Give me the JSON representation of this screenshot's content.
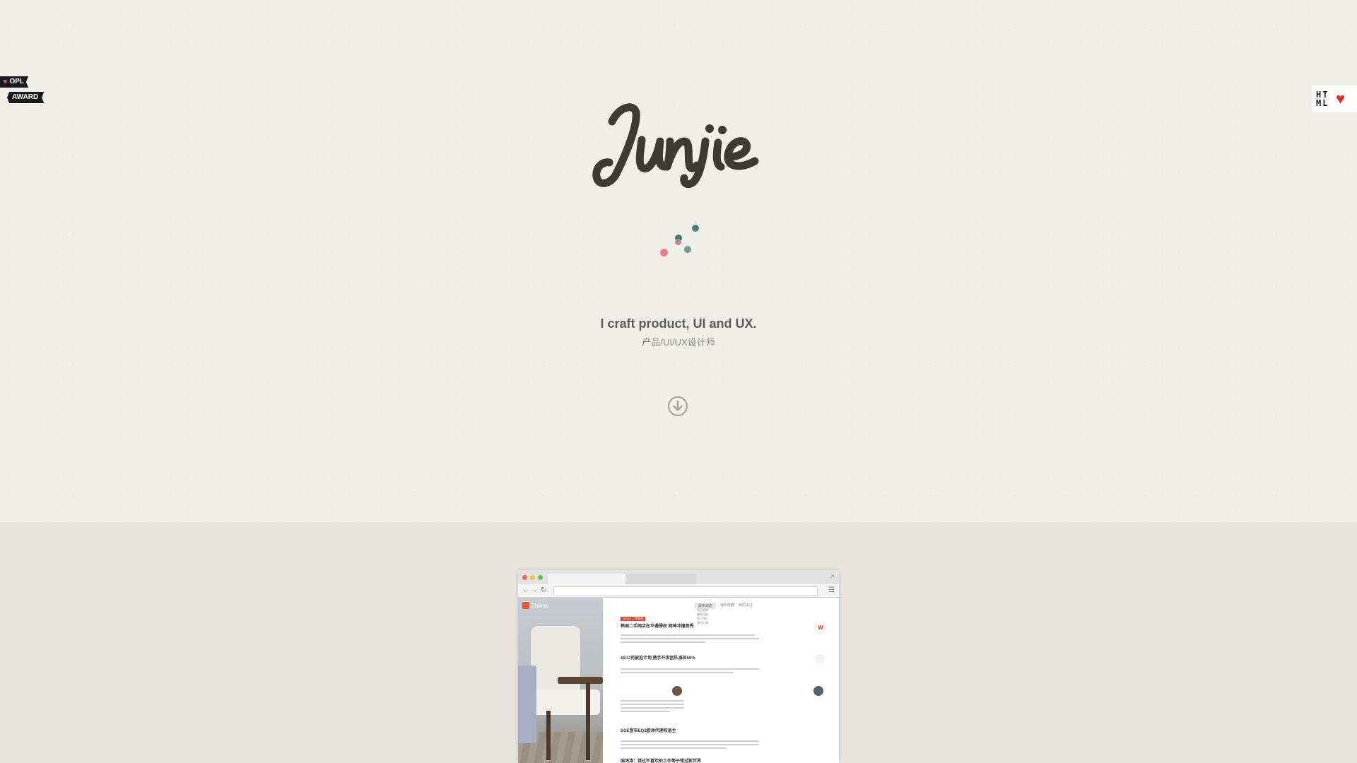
{
  "badges": {
    "opl_top": "OPL",
    "opl_bottom": "AWARD",
    "html_letters": "HTML"
  },
  "hero": {
    "logo_text": "Junjie",
    "tagline": "I craft product, UI and UX.",
    "subtagline": "产品/UI/UX设计师"
  },
  "colors": {
    "background": "#f2efe9",
    "showcase_background": "#e9e6e0",
    "logo": "#3e3a36",
    "dot_pink": "#e8808a",
    "dot_teal": "#4f7f80",
    "dot_green": "#3e7a6a",
    "dot_blue": "#6a9aa2",
    "dot_mauve": "#a8919a"
  },
  "icons": {
    "scroll_down": "circle-arrow-down-icon",
    "opl_heart": "heart-icon",
    "html_heart": "heart-icon"
  },
  "browser_mock": {
    "brand": "Zhimai",
    "tag": "NEWS 二手新闻",
    "tabs": [
      "最新动态",
      "我的收藏",
      "我的关注"
    ],
    "dropdown": [
      "浏览全部",
      "最新动态",
      "热门排行",
      "我的订阅"
    ],
    "headlines": [
      "韩国二手网店在华遇侵权 网神冲撞首秀",
      "SE公司被迫计划 携手开发团队减员50%",
      "SOE宣布EQ2欧洲代理权易主",
      "国鸿涛：错过不喜欢的工作等于错过新世界"
    ]
  }
}
